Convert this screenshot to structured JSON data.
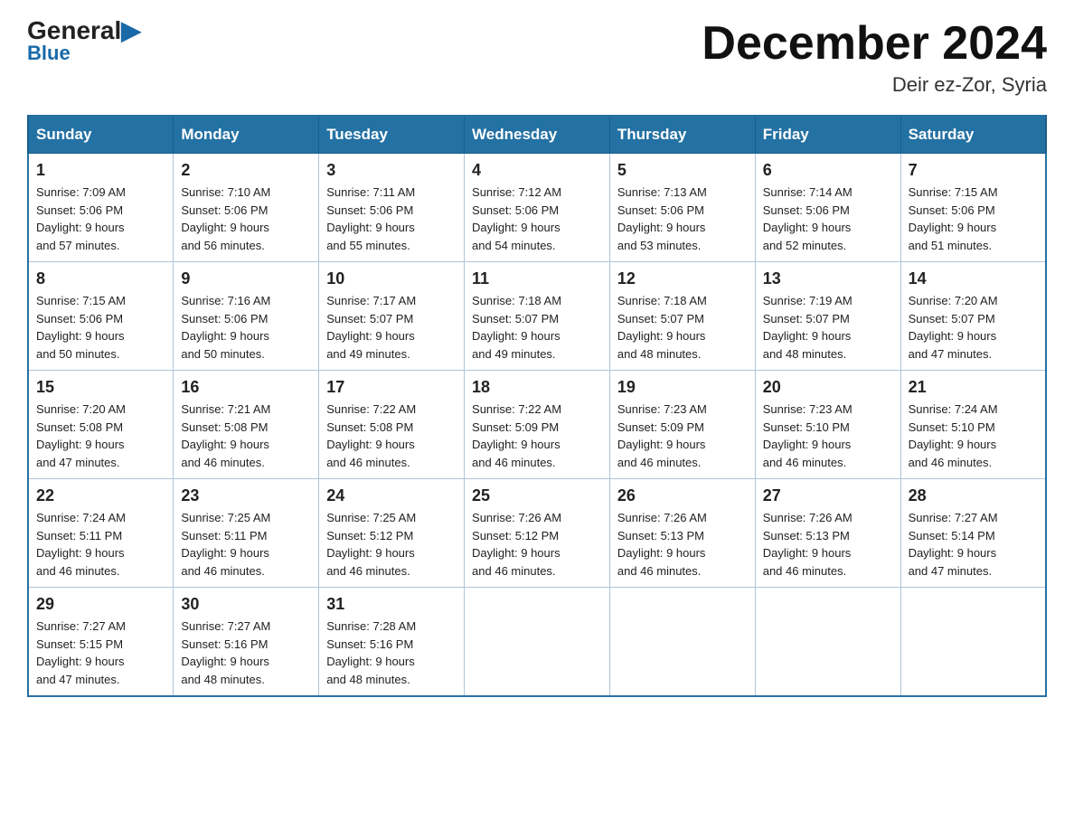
{
  "header": {
    "logo_general": "General",
    "logo_blue": "Blue",
    "month_title": "December 2024",
    "location": "Deir ez-Zor, Syria"
  },
  "days_of_week": [
    "Sunday",
    "Monday",
    "Tuesday",
    "Wednesday",
    "Thursday",
    "Friday",
    "Saturday"
  ],
  "weeks": [
    [
      {
        "day": "1",
        "sunrise": "7:09 AM",
        "sunset": "5:06 PM",
        "daylight": "9 hours and 57 minutes."
      },
      {
        "day": "2",
        "sunrise": "7:10 AM",
        "sunset": "5:06 PM",
        "daylight": "9 hours and 56 minutes."
      },
      {
        "day": "3",
        "sunrise": "7:11 AM",
        "sunset": "5:06 PM",
        "daylight": "9 hours and 55 minutes."
      },
      {
        "day": "4",
        "sunrise": "7:12 AM",
        "sunset": "5:06 PM",
        "daylight": "9 hours and 54 minutes."
      },
      {
        "day": "5",
        "sunrise": "7:13 AM",
        "sunset": "5:06 PM",
        "daylight": "9 hours and 53 minutes."
      },
      {
        "day": "6",
        "sunrise": "7:14 AM",
        "sunset": "5:06 PM",
        "daylight": "9 hours and 52 minutes."
      },
      {
        "day": "7",
        "sunrise": "7:15 AM",
        "sunset": "5:06 PM",
        "daylight": "9 hours and 51 minutes."
      }
    ],
    [
      {
        "day": "8",
        "sunrise": "7:15 AM",
        "sunset": "5:06 PM",
        "daylight": "9 hours and 50 minutes."
      },
      {
        "day": "9",
        "sunrise": "7:16 AM",
        "sunset": "5:06 PM",
        "daylight": "9 hours and 50 minutes."
      },
      {
        "day": "10",
        "sunrise": "7:17 AM",
        "sunset": "5:07 PM",
        "daylight": "9 hours and 49 minutes."
      },
      {
        "day": "11",
        "sunrise": "7:18 AM",
        "sunset": "5:07 PM",
        "daylight": "9 hours and 49 minutes."
      },
      {
        "day": "12",
        "sunrise": "7:18 AM",
        "sunset": "5:07 PM",
        "daylight": "9 hours and 48 minutes."
      },
      {
        "day": "13",
        "sunrise": "7:19 AM",
        "sunset": "5:07 PM",
        "daylight": "9 hours and 48 minutes."
      },
      {
        "day": "14",
        "sunrise": "7:20 AM",
        "sunset": "5:07 PM",
        "daylight": "9 hours and 47 minutes."
      }
    ],
    [
      {
        "day": "15",
        "sunrise": "7:20 AM",
        "sunset": "5:08 PM",
        "daylight": "9 hours and 47 minutes."
      },
      {
        "day": "16",
        "sunrise": "7:21 AM",
        "sunset": "5:08 PM",
        "daylight": "9 hours and 46 minutes."
      },
      {
        "day": "17",
        "sunrise": "7:22 AM",
        "sunset": "5:08 PM",
        "daylight": "9 hours and 46 minutes."
      },
      {
        "day": "18",
        "sunrise": "7:22 AM",
        "sunset": "5:09 PM",
        "daylight": "9 hours and 46 minutes."
      },
      {
        "day": "19",
        "sunrise": "7:23 AM",
        "sunset": "5:09 PM",
        "daylight": "9 hours and 46 minutes."
      },
      {
        "day": "20",
        "sunrise": "7:23 AM",
        "sunset": "5:10 PM",
        "daylight": "9 hours and 46 minutes."
      },
      {
        "day": "21",
        "sunrise": "7:24 AM",
        "sunset": "5:10 PM",
        "daylight": "9 hours and 46 minutes."
      }
    ],
    [
      {
        "day": "22",
        "sunrise": "7:24 AM",
        "sunset": "5:11 PM",
        "daylight": "9 hours and 46 minutes."
      },
      {
        "day": "23",
        "sunrise": "7:25 AM",
        "sunset": "5:11 PM",
        "daylight": "9 hours and 46 minutes."
      },
      {
        "day": "24",
        "sunrise": "7:25 AM",
        "sunset": "5:12 PM",
        "daylight": "9 hours and 46 minutes."
      },
      {
        "day": "25",
        "sunrise": "7:26 AM",
        "sunset": "5:12 PM",
        "daylight": "9 hours and 46 minutes."
      },
      {
        "day": "26",
        "sunrise": "7:26 AM",
        "sunset": "5:13 PM",
        "daylight": "9 hours and 46 minutes."
      },
      {
        "day": "27",
        "sunrise": "7:26 AM",
        "sunset": "5:13 PM",
        "daylight": "9 hours and 46 minutes."
      },
      {
        "day": "28",
        "sunrise": "7:27 AM",
        "sunset": "5:14 PM",
        "daylight": "9 hours and 47 minutes."
      }
    ],
    [
      {
        "day": "29",
        "sunrise": "7:27 AM",
        "sunset": "5:15 PM",
        "daylight": "9 hours and 47 minutes."
      },
      {
        "day": "30",
        "sunrise": "7:27 AM",
        "sunset": "5:16 PM",
        "daylight": "9 hours and 48 minutes."
      },
      {
        "day": "31",
        "sunrise": "7:28 AM",
        "sunset": "5:16 PM",
        "daylight": "9 hours and 48 minutes."
      },
      null,
      null,
      null,
      null
    ]
  ],
  "labels": {
    "sunrise": "Sunrise:",
    "sunset": "Sunset:",
    "daylight": "Daylight:"
  }
}
